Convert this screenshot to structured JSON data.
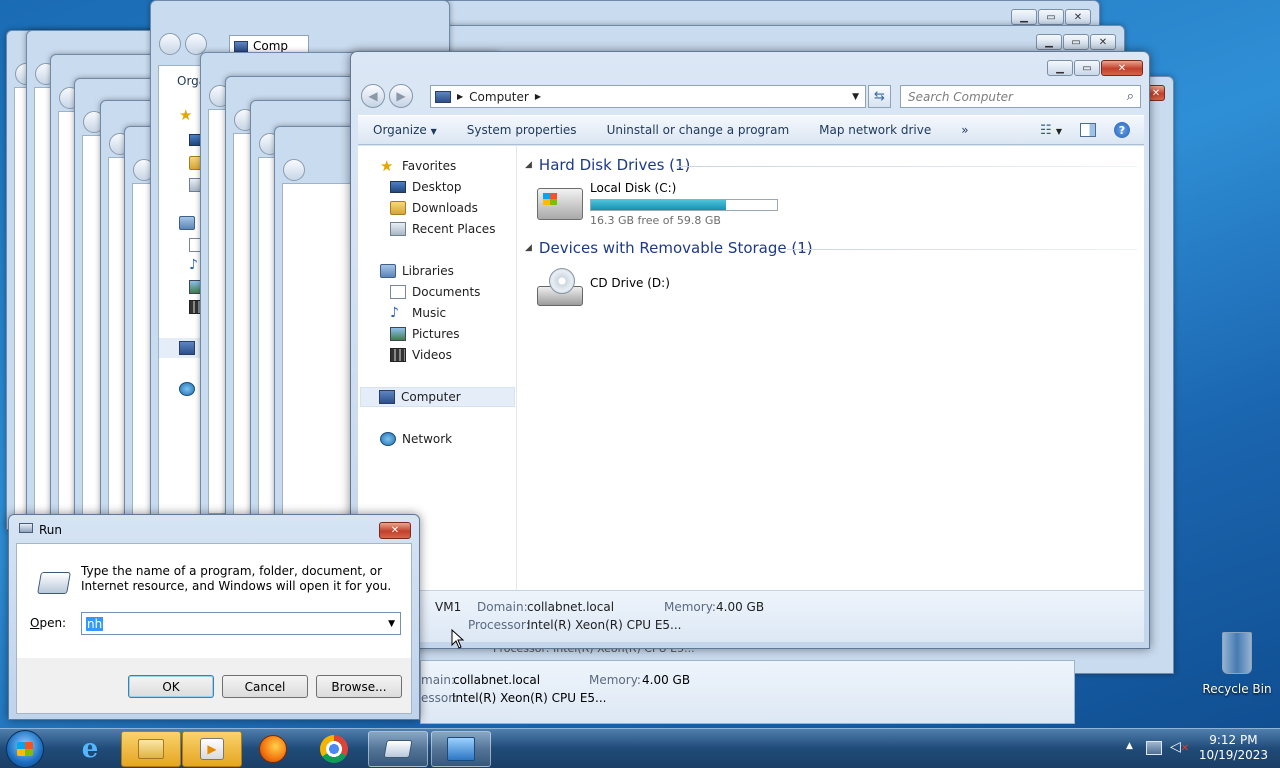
{
  "main_window": {
    "breadcrumb": "Computer",
    "search_placeholder": "Search Computer",
    "toolbar": [
      "Organize",
      "System properties",
      "Uninstall or change a program",
      "Map network drive",
      "»"
    ],
    "nav": {
      "favorites_label": "Favorites",
      "favorites": [
        "Desktop",
        "Downloads",
        "Recent Places"
      ],
      "libraries_label": "Libraries",
      "libraries": [
        "Documents",
        "Music",
        "Pictures",
        "Videos"
      ],
      "computer_label": "Computer",
      "network_label": "Network"
    },
    "groups": {
      "hdd_header": "Hard Disk Drives (1)",
      "removable_header": "Devices with Removable Storage (1)"
    },
    "local_disk": {
      "name": "Local Disk (C:)",
      "free_text": "16.3 GB free of 59.8 GB",
      "used_fraction": 0.727
    },
    "cd_drive": {
      "name": "CD Drive (D:)"
    },
    "details": {
      "name": "VM1",
      "domain_label": "Domain:",
      "domain": "collabnet.local",
      "memory_label": "Memory:",
      "memory": "4.00 GB",
      "processor_label": "Processor:",
      "processor": "Intel(R) Xeon(R) CPU E5..."
    }
  },
  "background_window": {
    "breadcrumb": "Comp",
    "organize_partial": "Orga",
    "domain_label_partial": "main:",
    "domain": "collabnet.local",
    "memory_label": "Memory:",
    "memory": "4.00 GB",
    "processor_label_partial": "essor:",
    "processor": "Intel(R) Xeon(R) CPU E5...",
    "processor_clipped": "Processor: Intel(R) Xeon(R) CPU E5..."
  },
  "run_dialog": {
    "title": "Run",
    "description": "Type the name of a program, folder, document, or Internet resource, and Windows will open it for you.",
    "open_label": "Open:",
    "open_value": "nh",
    "ok": "OK",
    "cancel": "Cancel",
    "browse": "Browse..."
  },
  "desktop": {
    "recycle_bin": "Recycle Bin"
  },
  "taskbar": {
    "time": "9:12 PM",
    "date": "10/19/2023"
  },
  "colors": {
    "accent": "#1e3a87",
    "progress": "#1790b0",
    "close": "#c1412b"
  }
}
